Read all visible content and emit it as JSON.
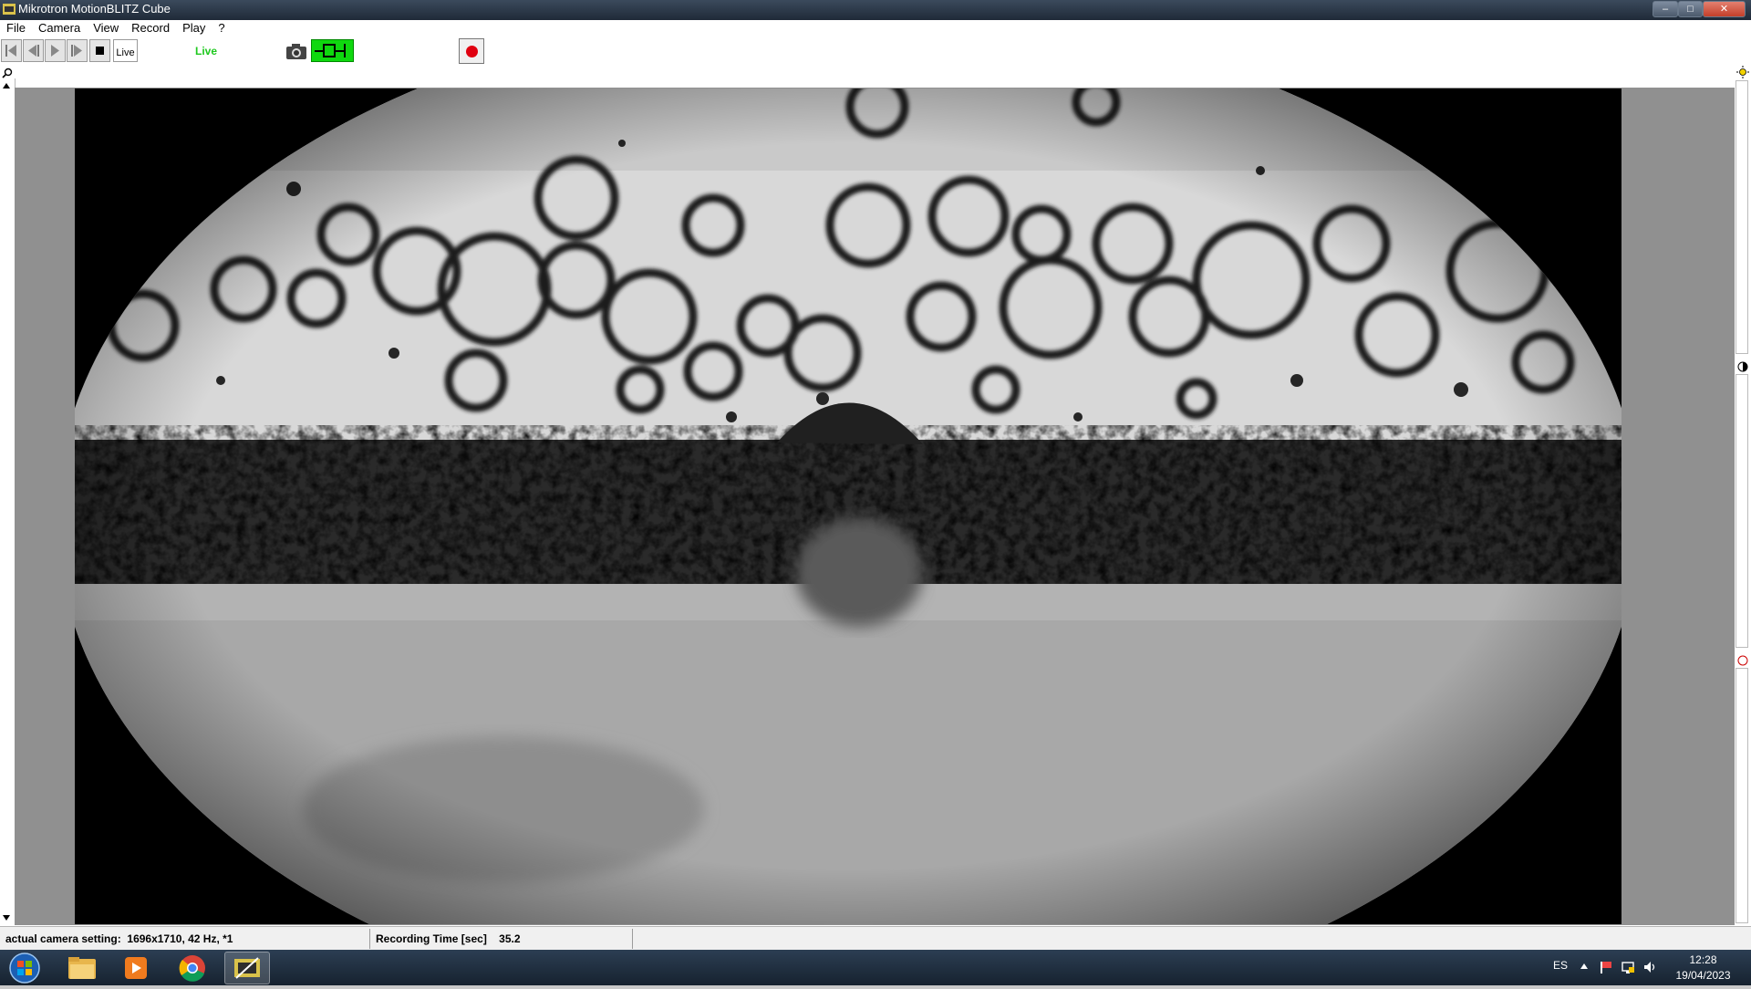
{
  "window": {
    "title": "Mikrotron MotionBLITZ Cube"
  },
  "menu": [
    "File",
    "Camera",
    "View",
    "Record",
    "Play",
    "?"
  ],
  "toolbar": {
    "live_button_label": "Live",
    "live_status": "Live"
  },
  "icons": [
    "skip-back-icon",
    "step-back-icon",
    "play-icon",
    "step-forward-icon",
    "stop-icon",
    "camera-icon",
    "trigger-icon",
    "record-icon",
    "zoom-icon",
    "brightness-icon",
    "contrast-icon"
  ],
  "status": {
    "camera_setting_label": "actual camera setting:",
    "camera_setting_value": "1696x1710, 42 Hz, *1",
    "recording_time_label": "Recording Time [sec]",
    "recording_time_value": "35.2"
  },
  "taskbar": {
    "language": "ES",
    "time": "12:28",
    "date": "19/04/2023",
    "apps": [
      "start-orb",
      "file-explorer",
      "media-player",
      "chrome",
      "motionblitz"
    ]
  },
  "colors": {
    "live_green": "#1fc81f",
    "trigger_green": "#0fd80f",
    "record_red": "#e00010"
  }
}
